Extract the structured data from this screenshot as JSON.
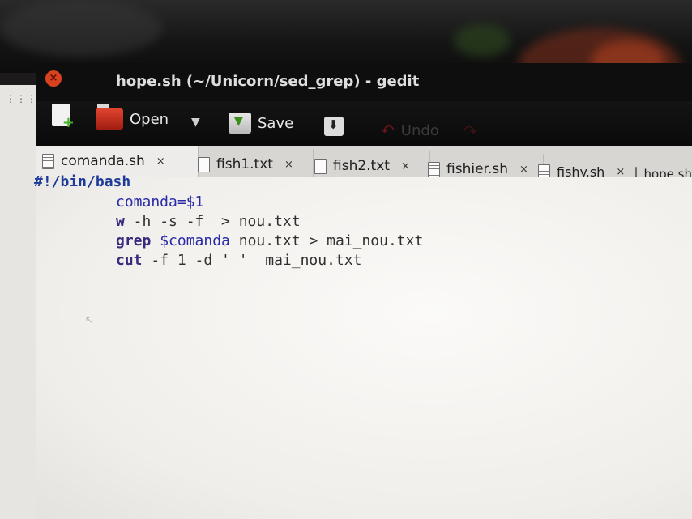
{
  "window": {
    "title": "hope.sh (~/Unicorn/sed_grep) - gedit",
    "close_glyph": "×"
  },
  "toolbar": {
    "new_icon": "new-document-icon",
    "open_label": "Open",
    "open_menu_glyph": "▼",
    "save_label": "Save",
    "print_icon": "print-icon",
    "undo_label": "Undo"
  },
  "tabs": [
    {
      "label": "comanda.sh",
      "close": "×",
      "icon": "script-file-icon"
    },
    {
      "label": "fish1.txt",
      "close": "×",
      "icon": "text-file-icon"
    },
    {
      "label": "fish2.txt",
      "close": "×",
      "icon": "text-file-icon"
    },
    {
      "label": "fishier.sh",
      "close": "×",
      "icon": "script-file-icon"
    },
    {
      "label": "fishy.sh",
      "close": "×",
      "icon": "script-file-icon"
    },
    {
      "label": "hope.sh",
      "icon": "script-file-icon"
    }
  ],
  "editor": {
    "shebang": "#!/bin/bash",
    "lines": [
      {
        "parts": [
          {
            "t": "comanda=$1",
            "c": "var"
          }
        ]
      },
      {
        "parts": [
          {
            "t": "w",
            "c": "kw"
          },
          {
            "t": " -h -s -f  > nou.txt",
            "c": "plain"
          }
        ]
      },
      {
        "parts": [
          {
            "t": "grep",
            "c": "kw"
          },
          {
            "t": " ",
            "c": "plain"
          },
          {
            "t": "$comanda",
            "c": "var"
          },
          {
            "t": " nou.txt > mai_nou.txt",
            "c": "plain"
          }
        ]
      },
      {
        "parts": [
          {
            "t": "cut",
            "c": "kw"
          },
          {
            "t": " -f 1 -d ' '  mai_nou.txt",
            "c": "plain"
          }
        ]
      }
    ]
  },
  "colors": {
    "keyword": "#3b2a7d",
    "variable": "#2a2aa8",
    "shebang": "#1f3b9a",
    "close_button": "#d9421f"
  }
}
